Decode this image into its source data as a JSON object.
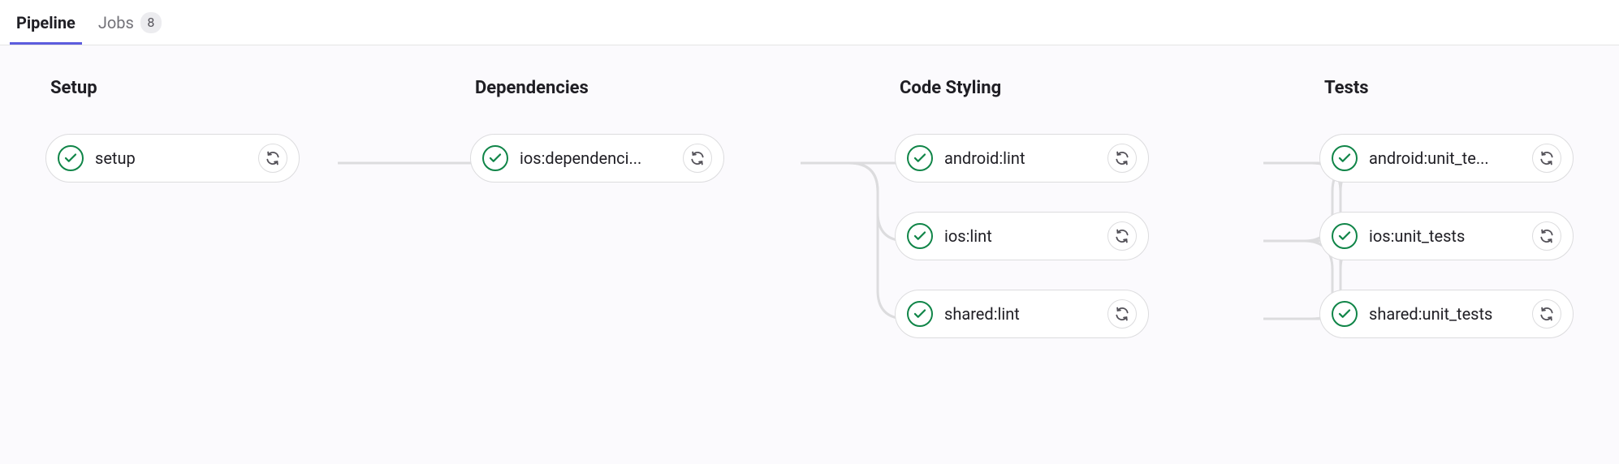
{
  "tabs": {
    "pipeline": {
      "label": "Pipeline"
    },
    "jobs": {
      "label": "Jobs",
      "count": "8"
    }
  },
  "stages": [
    {
      "title": "Setup",
      "jobs": [
        {
          "name": "setup",
          "status": "success"
        }
      ]
    },
    {
      "title": "Dependencies",
      "jobs": [
        {
          "name": "ios:dependenci...",
          "status": "success"
        }
      ]
    },
    {
      "title": "Code Styling",
      "jobs": [
        {
          "name": "android:lint",
          "status": "success"
        },
        {
          "name": "ios:lint",
          "status": "success"
        },
        {
          "name": "shared:lint",
          "status": "success"
        }
      ]
    },
    {
      "title": "Tests",
      "jobs": [
        {
          "name": "android:unit_te...",
          "status": "success"
        },
        {
          "name": "ios:unit_tests",
          "status": "success"
        },
        {
          "name": "shared:unit_tests",
          "status": "success"
        }
      ]
    }
  ],
  "colors": {
    "success": "#108548",
    "accent": "#5c5cde"
  }
}
